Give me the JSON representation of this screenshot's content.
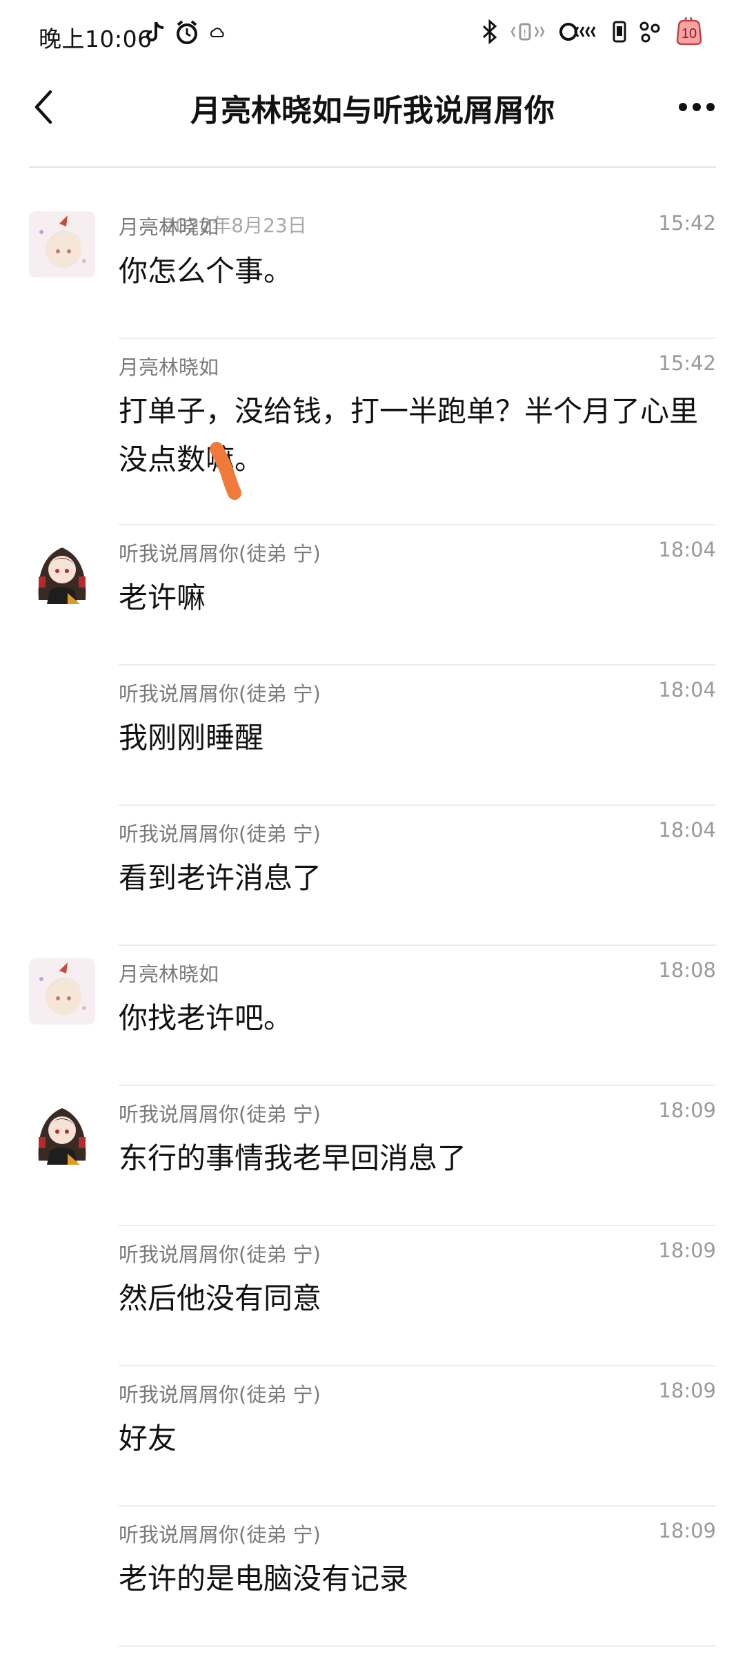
{
  "status_bar": {
    "time": "晚上10:06",
    "battery_badge": "10",
    "icons": [
      "tiktok-icon",
      "alarm-icon",
      "cloud-icon",
      "bluetooth-icon",
      "vibrate-icon",
      "no-signal-icon",
      "sim-icon",
      "hotspot-icon",
      "battery-icon"
    ]
  },
  "header": {
    "title": "月亮林晓如与听我说屑屑你",
    "back_icon": "chevron-left-icon",
    "more_icon": "more-dots-icon"
  },
  "date_divider": "2022年8月23日",
  "messages": [
    {
      "sender": "月亮林晓如",
      "time": "15:42",
      "text": "你怎么个事。",
      "avatar": "avatar-moon"
    },
    {
      "sender": "月亮林晓如",
      "time": "15:42",
      "text": "打单子，没给钱，打一半跑单？半个月了心里没点数嘛。",
      "avatar": ""
    },
    {
      "sender": "听我说屑屑你(徒弟 宁)",
      "time": "18:04",
      "text": "老许嘛",
      "avatar": "avatar-ning"
    },
    {
      "sender": "听我说屑屑你(徒弟 宁)",
      "time": "18:04",
      "text": "我刚刚睡醒",
      "avatar": ""
    },
    {
      "sender": "听我说屑屑你(徒弟 宁)",
      "time": "18:04",
      "text": "看到老许消息了",
      "avatar": ""
    },
    {
      "sender": "月亮林晓如",
      "time": "18:08",
      "text": "你找老许吧。",
      "avatar": "avatar-moon"
    },
    {
      "sender": "听我说屑屑你(徒弟 宁)",
      "time": "18:09",
      "text": "东行的事情我老早回消息了",
      "avatar": "avatar-ning"
    },
    {
      "sender": "听我说屑屑你(徒弟 宁)",
      "time": "18:09",
      "text": "然后他没有同意",
      "avatar": ""
    },
    {
      "sender": "听我说屑屑你(徒弟 宁)",
      "time": "18:09",
      "text": "好友",
      "avatar": ""
    },
    {
      "sender": "听我说屑屑你(徒弟 宁)",
      "time": "18:09",
      "text": "老许的是电脑没有记录",
      "avatar": ""
    }
  ],
  "colors": {
    "scribble": "#f07a3a",
    "divider": "#ececec"
  }
}
